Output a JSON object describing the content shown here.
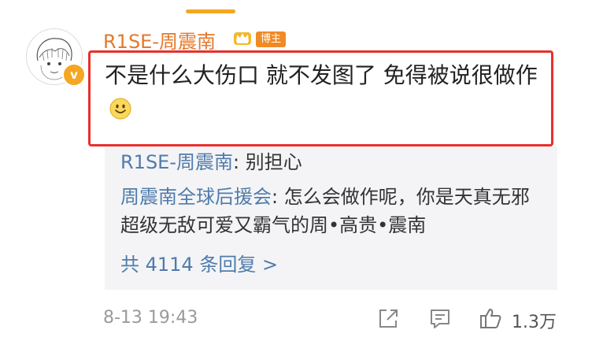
{
  "comment": {
    "username": "R1SE-周震南",
    "verified_badge": "v",
    "blogger_badge": "博主",
    "text": "不是什么大伤口 就不发图了 免得被说很做作"
  },
  "replies": [
    {
      "author": "R1SE-周震南",
      "text": ": 别担心"
    },
    {
      "author": "周震南全球后援会",
      "text": ": 怎么会做作呢，你是天真无邪超级无敌可爱又霸气的周•高贵•震南"
    }
  ],
  "more_replies": "共 4114 条回复 >",
  "footer": {
    "timestamp": "8-13 19:43",
    "likes": "1.3万"
  },
  "colors": {
    "username": "#e4792b",
    "highlight": "#e8302c",
    "link": "#4f7cab",
    "badge": "#f08a24"
  },
  "icons": [
    "crown-icon",
    "smile-emoji-icon",
    "share-icon",
    "comment-icon",
    "like-icon"
  ]
}
